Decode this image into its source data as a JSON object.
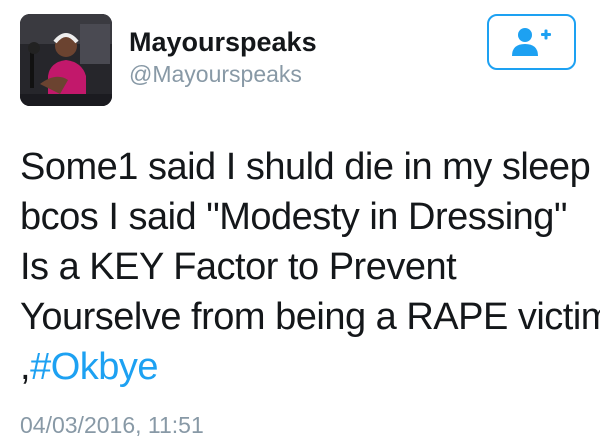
{
  "user": {
    "display_name": "Mayourspeaks",
    "handle": "@Mayourspeaks"
  },
  "follow_button": {
    "icon": "add-user-icon"
  },
  "tweet": {
    "lines": [
      "Some1 said I shuld die in my sleep",
      "bcos I said \"Modesty in Dressing\"",
      "Is a KEY Factor to Prevent",
      "Yourselve from being a RAPE victim"
    ],
    "last_line_prefix": ",",
    "hashtag": "#Okbye",
    "timestamp": "04/03/2016, 11:51"
  },
  "colors": {
    "accent": "#1da1f2",
    "text": "#14171a",
    "muted": "#8899a6"
  }
}
